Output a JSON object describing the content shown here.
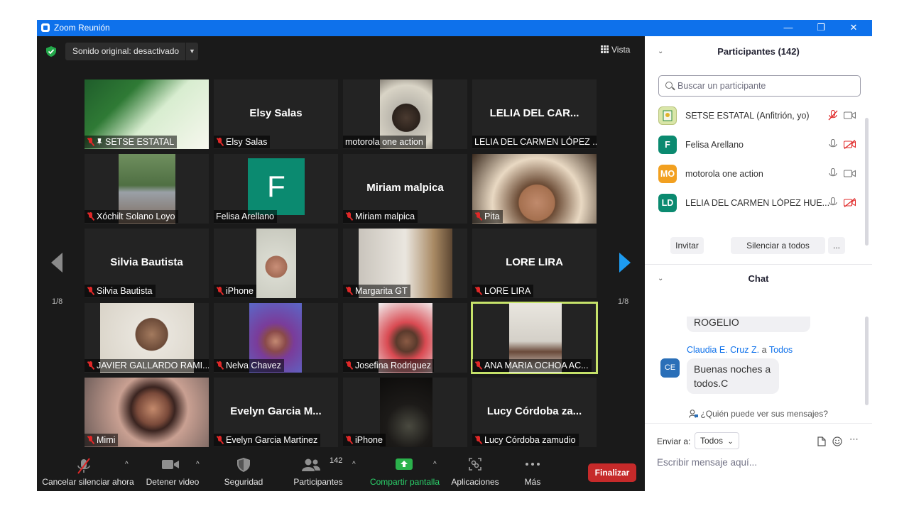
{
  "window": {
    "title": "Zoom Reunión"
  },
  "top_bar": {
    "audio_label": "Sonido original: desactivado",
    "view_label": "Vista"
  },
  "pager": {
    "left_label": "1/8",
    "right_label": "1/8"
  },
  "tiles": [
    {
      "big_name": "",
      "name": "SETSE ESTATAL",
      "muted": true,
      "pinned": true,
      "video": "festejo"
    },
    {
      "big_name": "Elsy Salas",
      "name": "Elsy Salas",
      "muted": true
    },
    {
      "big_name": "",
      "name": "motorola one action",
      "muted": false,
      "video": "room-dark"
    },
    {
      "big_name": "LELIA DEL CAR...",
      "name": "LELIA DEL CARMEN LÓPEZ ...",
      "muted": false
    },
    {
      "big_name": "",
      "name": "Xóchilt Solano Loyo",
      "muted": true,
      "video": "garden"
    },
    {
      "big_name": "",
      "name": "Felisa Arellano",
      "muted": false,
      "avatar": "F"
    },
    {
      "big_name": "Miriam malpica",
      "name": "Miriam malpica",
      "muted": true
    },
    {
      "big_name": "",
      "name": "Pita",
      "muted": true,
      "video": "warm"
    },
    {
      "big_name": "Silvia Bautista",
      "name": "Silvia Bautista",
      "muted": true
    },
    {
      "big_name": "",
      "name": "iPhone",
      "muted": true,
      "video": "lady-red"
    },
    {
      "big_name": "",
      "name": "Margarita GT",
      "muted": true,
      "video": "ceiling"
    },
    {
      "big_name": "LORE LIRA",
      "name": "LORE LIRA",
      "muted": true
    },
    {
      "big_name": "",
      "name": "JAVIER GALLARDO RAMI...",
      "muted": true,
      "video": "man"
    },
    {
      "big_name": "",
      "name": "Nelva Chavez",
      "muted": true,
      "video": "purple"
    },
    {
      "big_name": "",
      "name": "Josefina Rodriguez",
      "muted": true,
      "video": "red"
    },
    {
      "big_name": "",
      "name": "ANA MARIA OCHOA AC...",
      "muted": true,
      "video": "stairs",
      "speaking": true
    },
    {
      "big_name": "",
      "name": "Mimi",
      "muted": true,
      "video": "mimi"
    },
    {
      "big_name": "Evelyn Garcia M...",
      "name": "Evelyn Garcia Martinez",
      "muted": true
    },
    {
      "big_name": "",
      "name": "iPhone",
      "muted": true,
      "video": "dark"
    },
    {
      "big_name": "Lucy Córdoba za...",
      "name": "Lucy Córdoba zamudio",
      "muted": true
    }
  ],
  "toolbar": {
    "unmute": "Cancelar silenciar ahora",
    "video": "Detener video",
    "security": "Seguridad",
    "participants": "Participantes",
    "participants_count": "142",
    "share": "Compartir pantalla",
    "apps": "Aplicaciones",
    "more": "Más",
    "end": "Finalizar"
  },
  "participants_panel": {
    "title": "Participantes (142)",
    "search_placeholder": "Buscar un participante",
    "list": [
      {
        "initials": "",
        "name": "SETSE ESTATAL (Anfitrión, yo)",
        "mic_muted": true,
        "cam_off": false,
        "color": "#d9e6a8"
      },
      {
        "initials": "F",
        "name": "Felisa Arellano",
        "mic_muted": false,
        "cam_off": true,
        "color": "#0b8a70"
      },
      {
        "initials": "MO",
        "name": "motorola one action",
        "mic_muted": false,
        "cam_off": false,
        "color": "#f2a020"
      },
      {
        "initials": "LD",
        "name": "LELIA DEL CARMEN LÓPEZ HUE...",
        "mic_muted": false,
        "cam_off": true,
        "color": "#0b8a70"
      }
    ],
    "invite": "Invitar",
    "mute_all": "Silenciar a todos",
    "more": "..."
  },
  "chat": {
    "title": "Chat",
    "prev_message": "ROGELIO",
    "sender": "Claudia E. Cruz Z.",
    "to_word": "a",
    "recipient": "Todos",
    "sender_initials": "CE",
    "message": "Buenas noches a todos.C",
    "who_sees": "¿Quién puede ver sus mensajes?",
    "send_to_label": "Enviar a:",
    "send_to_value": "Todos",
    "input_placeholder": "Escribir mensaje aquí..."
  }
}
